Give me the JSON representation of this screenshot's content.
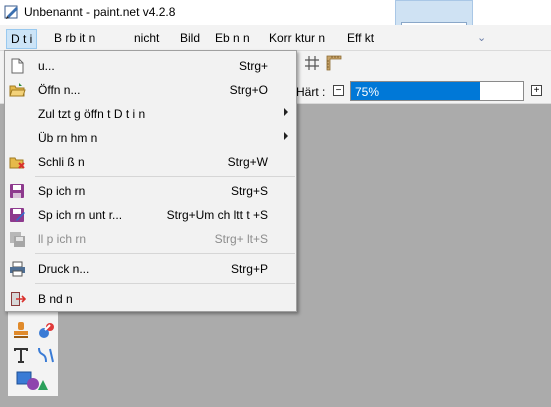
{
  "window": {
    "title": "Unbenannt - paint.net v4.2.8"
  },
  "menubar": {
    "items": [
      "D t i",
      "B rb it n",
      "nicht",
      "Bild",
      "Eb n n",
      "Korr ktur n",
      "Eff kt"
    ],
    "active": 0
  },
  "options": {
    "hardness_label": "Härt :",
    "hardness_value": "75%",
    "hardness_fraction": 0.75
  },
  "file_menu": {
    "items": [
      {
        "icon": "new-file-icon",
        "label": "u...",
        "shortcut": "Strg+",
        "submenu": false,
        "disabled": false
      },
      {
        "icon": "open-folder-icon",
        "label": "Öffn n...",
        "shortcut": "Strg+O",
        "submenu": false,
        "disabled": false
      },
      {
        "icon": "",
        "label": "Zul tzt g öffn t D t i n",
        "shortcut": "",
        "submenu": true,
        "disabled": false
      },
      {
        "icon": "",
        "label": "Üb rn hm n",
        "shortcut": "",
        "submenu": true,
        "disabled": false
      },
      {
        "icon": "close-folder-icon",
        "label": "Schli ß n",
        "shortcut": "Strg+W",
        "submenu": false,
        "disabled": false
      },
      {
        "icon": "save-icon",
        "label": "Sp ich rn",
        "shortcut": "Strg+S",
        "submenu": false,
        "disabled": false
      },
      {
        "icon": "save-as-icon",
        "label": "Sp ich rn unt r...",
        "shortcut": "Strg+Um ch ltt  t +S",
        "submenu": false,
        "disabled": false
      },
      {
        "icon": "save-all-icon",
        "label": "ll    p ich rn",
        "shortcut": "Strg+  lt+S",
        "submenu": false,
        "disabled": true
      },
      {
        "icon": "print-icon",
        "label": "Druck n...",
        "shortcut": "Strg+P",
        "submenu": false,
        "disabled": false
      },
      {
        "icon": "exit-icon",
        "label": "B  nd n",
        "shortcut": "",
        "submenu": false,
        "disabled": false
      }
    ]
  }
}
